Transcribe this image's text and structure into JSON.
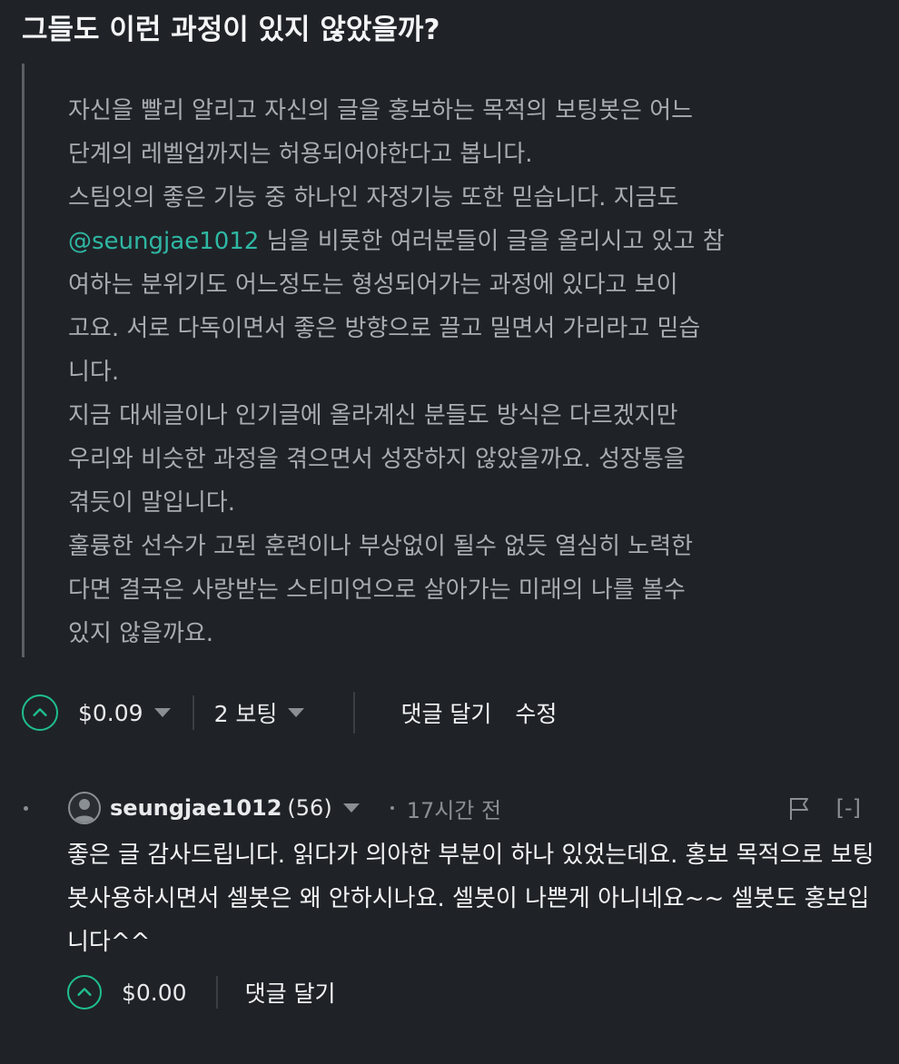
{
  "post": {
    "title": "그들도 이런 과정이 있지 않았을까?",
    "quote": {
      "text_before_mention": "자신을 빨리 알리고 자신의 글을 홍보하는 목적의 보팅봇은 어느\n단계의 레벨업까지는 허용되어야한다고 봅니다.\n스팀잇의 좋은 기능 중 하나인 자정기능 또한 믿습니다. 지금도\n",
      "mention": "@seungjae1012",
      "text_after_mention": " 님을 비롯한 여러분들이 글을 올리시고 있고 참\n여하는 분위기도 어느정도는 형성되어가는 과정에 있다고 보이\n고요. 서로 다독이면서 좋은 방향으로 끌고 밀면서 가리라고 믿습\n니다.\n지금 대세글이나 인기글에 올라계신 분들도 방식은 다르겠지만\n우리와 비슷한 과정을 겪으면서 성장하지 않았을까요. 성장통을\n겪듯이 말입니다.\n훌륭한 선수가 고된 훈련이나 부상없이 될수 없듯 열심히 노력한\n다면 결국은 사랑받는 스티미언으로 살아가는 미래의 나를 볼수\n있지 않을까요."
    },
    "actions": {
      "payout": "$0.09",
      "votes": "2 보팅",
      "reply": "댓글 달기",
      "edit": "수정"
    }
  },
  "comment": {
    "author": "seungjae1012",
    "reputation": "(56)",
    "time": "17시간 전",
    "collapse": "[-]",
    "body": "좋은 글 감사드립니다. 읽다가 의아한 부분이 하나 있었는데요. 홍보 목적으로 보팅봇사용하시면서 셀봇은 왜 안하시나요. 셀봇이 나쁜게 아니네요~~ 셀봇도 홍보입니다^^",
    "payout": "$0.00",
    "reply": "댓글 달기"
  },
  "colors": {
    "background": "#1f2327",
    "accent_green": "#1fbf8f",
    "mention": "#2fb7a4"
  },
  "icons": [
    "chevron-up-icon",
    "caret-down-icon",
    "avatar-icon",
    "flag-icon"
  ]
}
